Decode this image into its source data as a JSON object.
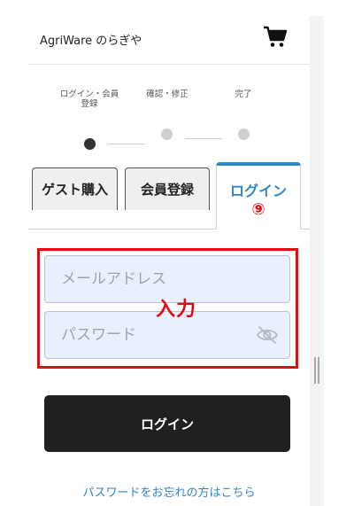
{
  "header": {
    "shop_name": "AgriWare のらぎや",
    "cart_icon": "cart-icon"
  },
  "steps": [
    {
      "label_line1": "ログイン・会員",
      "label_line2": "登録",
      "active": true
    },
    {
      "label_line1": "確認・修正",
      "label_line2": "",
      "active": false
    },
    {
      "label_line1": "完了",
      "label_line2": "",
      "active": false
    }
  ],
  "tabs": {
    "guest": "ゲスト購入",
    "register": "会員登録",
    "login": "ログイン",
    "login_marker": "⑨"
  },
  "form": {
    "email_placeholder": "メールアドレス",
    "password_placeholder": "パスワード",
    "annotation": "入力",
    "visibility_icon": "eye-off-icon"
  },
  "login_button": "ログイン",
  "forgot_link": "パスワードをお忘れの方はこちら",
  "colors": {
    "accent": "#2f87c8",
    "annotation_red": "#e10b12",
    "button_dark": "#202020",
    "field_bg": "#e8f0fe"
  }
}
